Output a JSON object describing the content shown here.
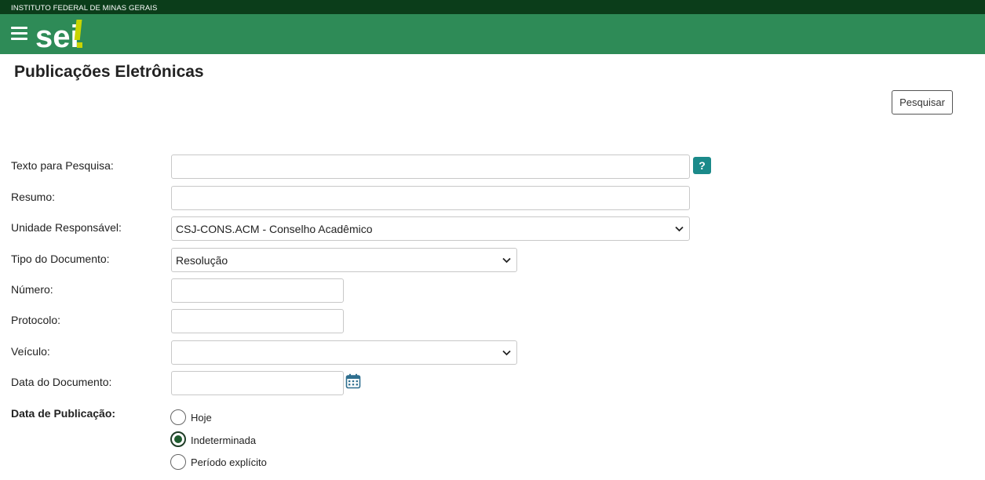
{
  "institution": "INSTITUTO FEDERAL DE MINAS GERAIS",
  "logo_text": "sei",
  "page_title": "Publicações Eletrônicas",
  "search_button": "Pesquisar",
  "help_label": "?",
  "form": {
    "texto": {
      "label": "Texto para Pesquisa:",
      "value": ""
    },
    "resumo": {
      "label": "Resumo:",
      "value": ""
    },
    "unidade": {
      "label": "Unidade Responsável:",
      "selected": "CSJ-CONS.ACM - Conselho Acadêmico"
    },
    "tipo": {
      "label": "Tipo do Documento:",
      "selected": "Resolução"
    },
    "numero": {
      "label": "Número:",
      "value": ""
    },
    "protocolo": {
      "label": "Protocolo:",
      "value": ""
    },
    "veiculo": {
      "label": "Veículo:",
      "selected": ""
    },
    "data_documento": {
      "label": "Data do Documento:",
      "value": ""
    },
    "data_publicacao": {
      "label": "Data de Publicação:",
      "options": [
        "Hoje",
        "Indeterminada",
        "Período explícito"
      ],
      "selected": "Indeterminada"
    }
  },
  "colors": {
    "header_green": "#2e8b57",
    "topstrip": "#0b3d1a",
    "logo_accent": "#c8d400",
    "help_teal": "#1b8a8a"
  }
}
